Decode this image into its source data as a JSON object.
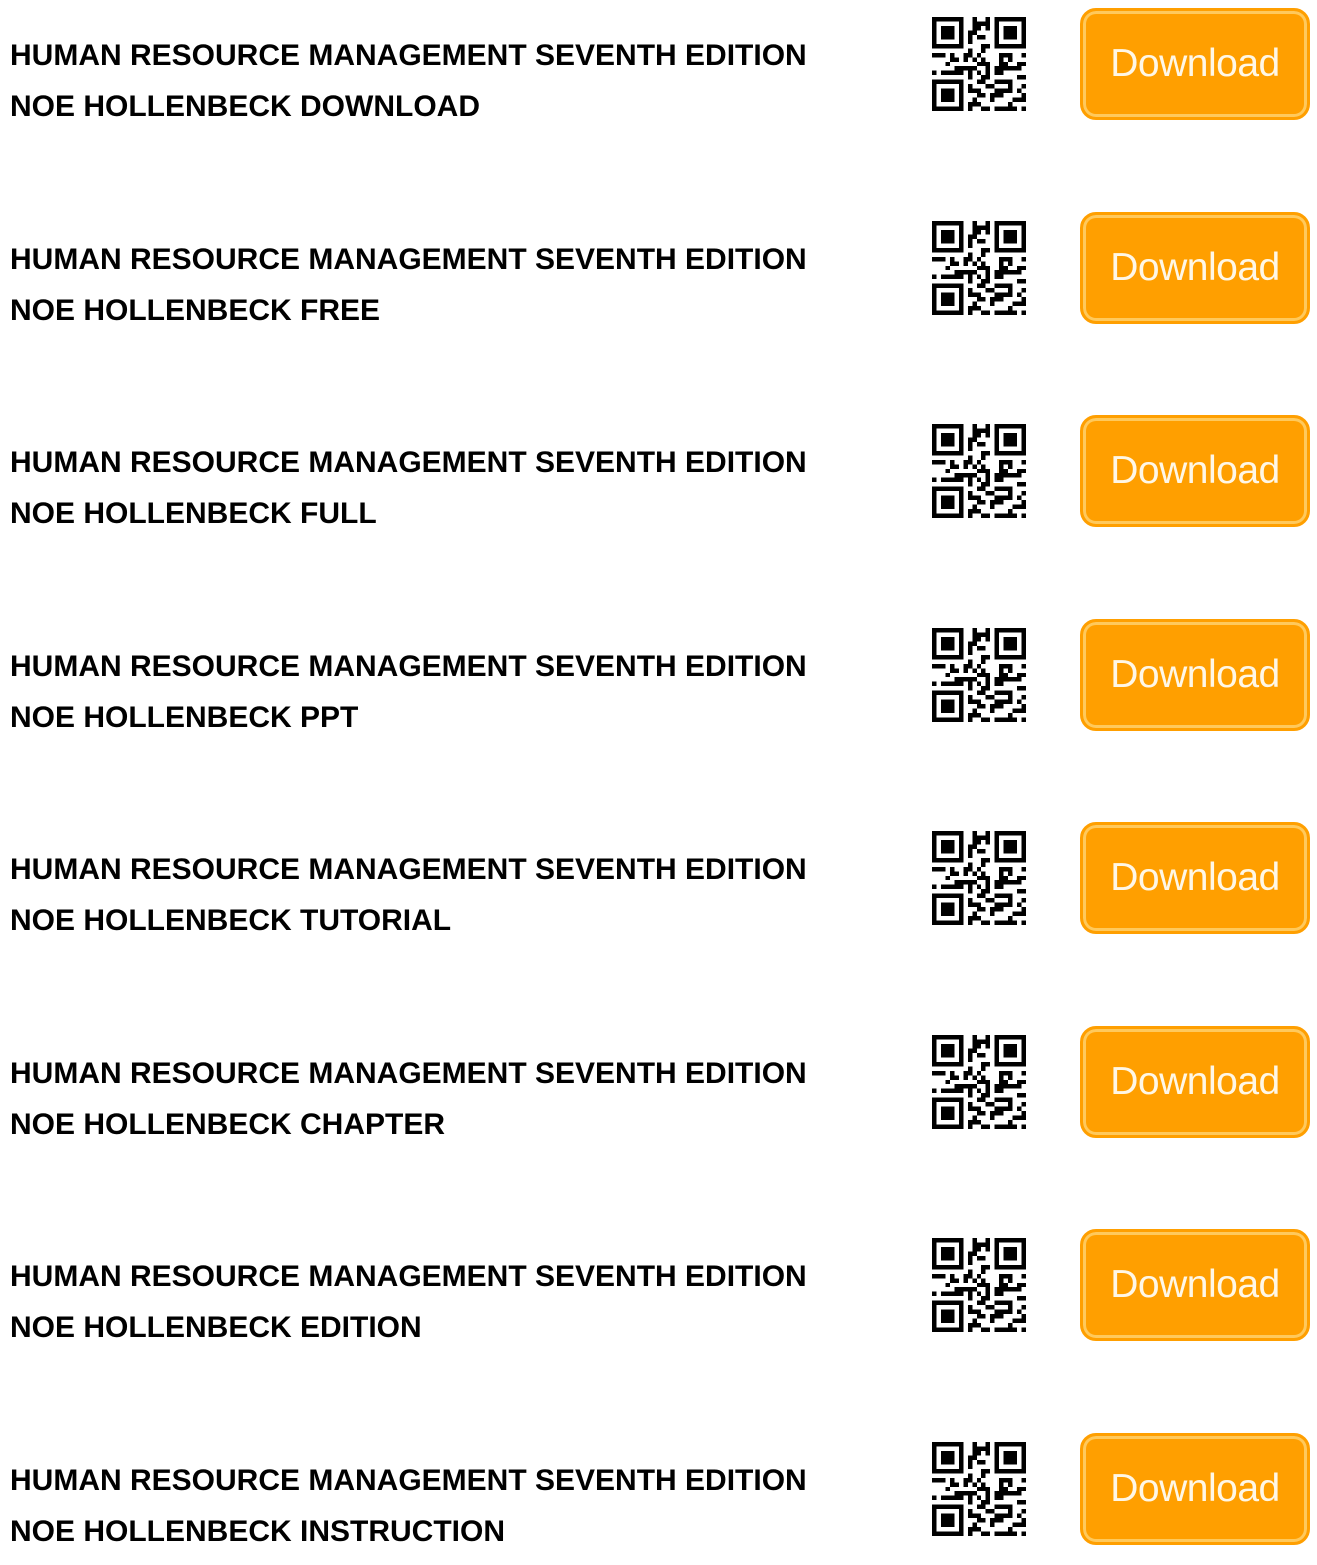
{
  "accent_color": "#ff9f00",
  "items": [
    {
      "line1": "HUMAN RESOURCE MANAGEMENT SEVENTH EDITION",
      "line2": "NOE HOLLENBECK DOWNLOAD",
      "button_label": "Download",
      "qr_icon": "qr-code-icon"
    },
    {
      "line1": "HUMAN RESOURCE MANAGEMENT SEVENTH EDITION",
      "line2": "NOE HOLLENBECK FREE",
      "button_label": "Download",
      "qr_icon": "qr-code-icon"
    },
    {
      "line1": "HUMAN RESOURCE MANAGEMENT SEVENTH EDITION",
      "line2": "NOE HOLLENBECK FULL",
      "button_label": "Download",
      "qr_icon": "qr-code-icon"
    },
    {
      "line1": "HUMAN RESOURCE MANAGEMENT SEVENTH EDITION",
      "line2": "NOE HOLLENBECK PPT",
      "button_label": "Download",
      "qr_icon": "qr-code-icon"
    },
    {
      "line1": "HUMAN RESOURCE MANAGEMENT SEVENTH EDITION",
      "line2": "NOE HOLLENBECK TUTORIAL",
      "button_label": "Download",
      "qr_icon": "qr-code-icon"
    },
    {
      "line1": "HUMAN RESOURCE MANAGEMENT SEVENTH EDITION",
      "line2": "NOE HOLLENBECK CHAPTER",
      "button_label": "Download",
      "qr_icon": "qr-code-icon"
    },
    {
      "line1": "HUMAN RESOURCE MANAGEMENT SEVENTH EDITION",
      "line2": "NOE HOLLENBECK EDITION",
      "button_label": "Download",
      "qr_icon": "qr-code-icon"
    },
    {
      "line1": "HUMAN RESOURCE MANAGEMENT SEVENTH EDITION",
      "line2": "NOE HOLLENBECK INSTRUCTION",
      "button_label": "Download",
      "qr_icon": "qr-code-icon"
    }
  ]
}
